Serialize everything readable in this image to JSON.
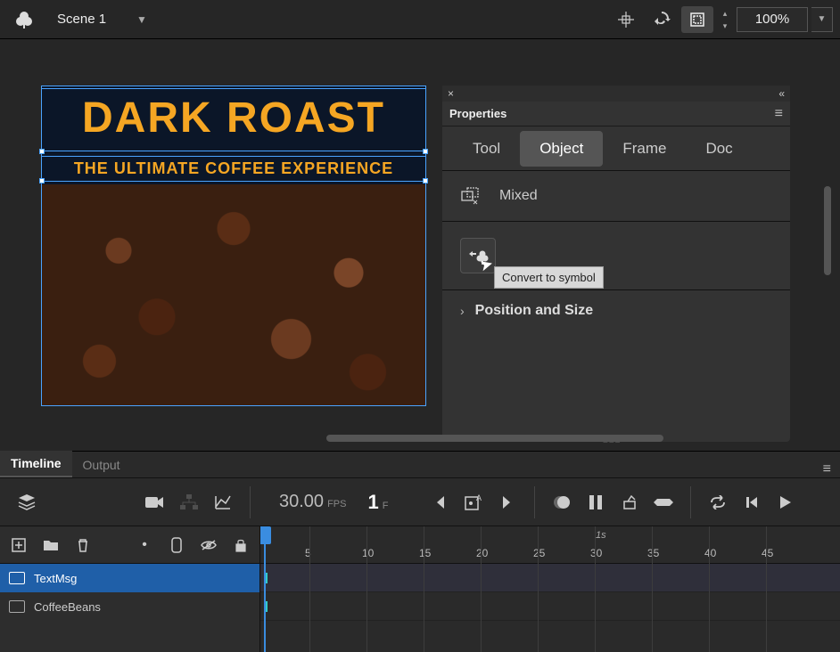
{
  "topbar": {
    "scene_label": "Scene 1",
    "zoom": "100%"
  },
  "canvas": {
    "title": "DARK ROAST",
    "subtitle": "THE ULTIMATE COFFEE EXPERIENCE"
  },
  "properties": {
    "panel_title": "Properties",
    "tabs": {
      "tool": "Tool",
      "object": "Object",
      "frame": "Frame",
      "doc": "Doc"
    },
    "mixed_label": "Mixed",
    "tooltip": "Convert to symbol",
    "position_size": "Position and Size"
  },
  "timeline": {
    "tabs": {
      "timeline": "Timeline",
      "output": "Output"
    },
    "fps": "30.00",
    "fps_label": "FPS",
    "frame": "1",
    "frame_label": "F",
    "ruler_sec": "1s",
    "ruler_ticks": [
      "5",
      "10",
      "15",
      "20",
      "25",
      "30",
      "35",
      "40",
      "45"
    ],
    "layers": [
      {
        "name": "TextMsg"
      },
      {
        "name": "CoffeeBeans"
      }
    ]
  }
}
